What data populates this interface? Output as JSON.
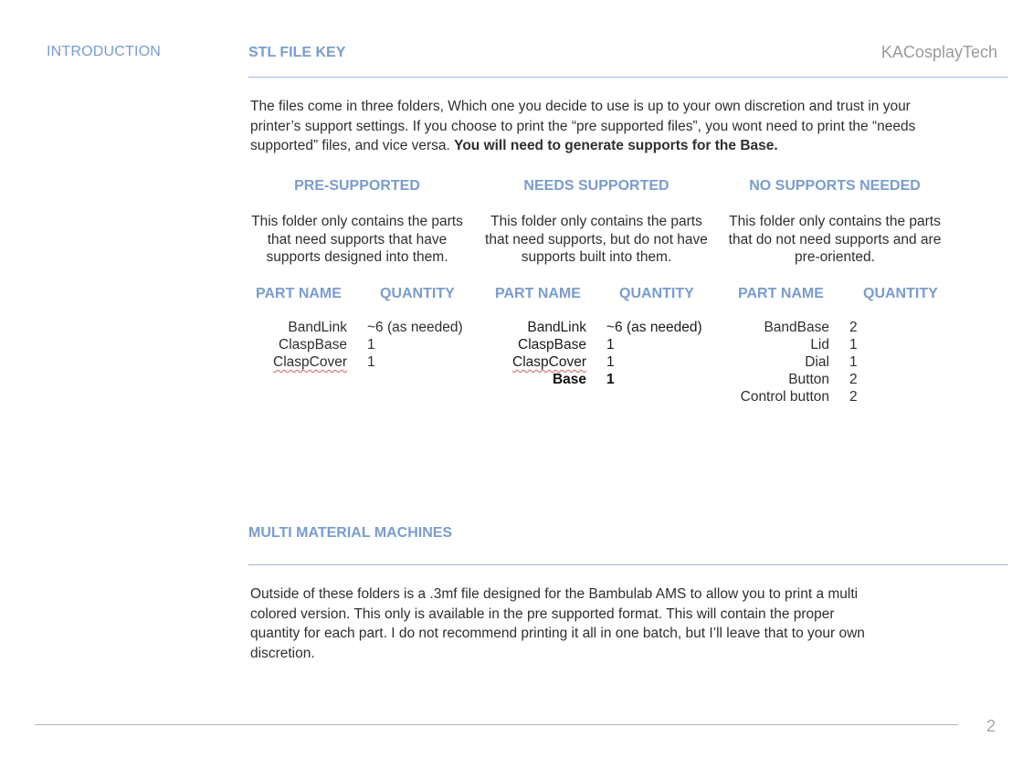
{
  "header": {
    "section": "INTRODUCTION",
    "brand": "KACosplayTech"
  },
  "stl": {
    "title": "STL FILE KEY",
    "intro": "The files come in three folders, Which  one you decide to use is up to your own discretion and trust in your printer’s support settings. If you choose to print the “pre supported files”, you wont need to print the “needs supported” files, and vice versa. ",
    "intro_bold": "You will need to generate supports for the Base.",
    "folders": [
      {
        "title": "PRE-SUPPORTED",
        "desc": "This folder only contains the parts that need supports that have supports designed into them.",
        "col_part": "PART NAME",
        "col_qty": "QUANTITY",
        "parts": [
          {
            "name": "BandLink",
            "qty": "~6 (as needed)"
          },
          {
            "name": "ClaspBase",
            "qty": "1"
          },
          {
            "name": "ClaspCover",
            "qty": "1"
          }
        ]
      },
      {
        "title": "NEEDS SUPPORTED",
        "desc": "This folder only contains the parts that need supports, but do not have supports built into them.",
        "col_part": "PART NAME",
        "col_qty": "QUANTITY",
        "parts": [
          {
            "name": "BandLink",
            "qty": "~6 (as needed)"
          },
          {
            "name": "ClaspBase",
            "qty": "1"
          },
          {
            "name": "ClaspCover",
            "qty": "1"
          },
          {
            "name": "Base",
            "qty": "1"
          }
        ]
      },
      {
        "title": "NO SUPPORTS NEEDED",
        "desc": "This folder only contains the parts that do not need supports and are pre-oriented.",
        "col_part": "PART NAME",
        "col_qty": "QUANTITY",
        "parts": [
          {
            "name": "BandBase",
            "qty": "2"
          },
          {
            "name": "Lid",
            "qty": "1"
          },
          {
            "name": "Dial",
            "qty": "1"
          },
          {
            "name": "Button",
            "qty": "2"
          },
          {
            "name": "Control button",
            "qty": "2"
          }
        ]
      }
    ]
  },
  "multi": {
    "title": "MULTI MATERIAL MACHINES",
    "text": "Outside of these folders is a .3mf  file designed for the Bambulab AMS to allow you to print a multi colored version. This only is available in the pre supported format. This will contain the proper quantity for each part. I do not recommend printing it all in one batch, but I’ll leave that to your own discretion."
  },
  "footer": {
    "page_number": "2"
  }
}
